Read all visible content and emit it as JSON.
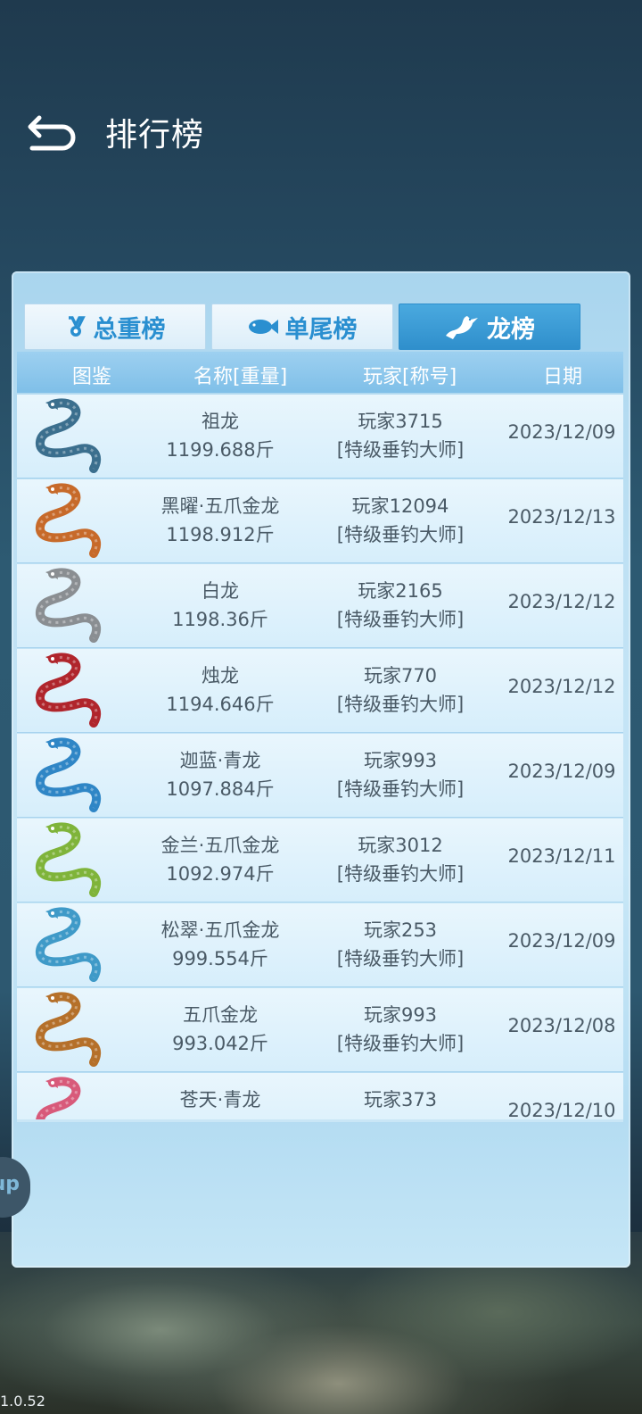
{
  "header": {
    "title": "排行榜"
  },
  "tabs": [
    {
      "label": "总重榜",
      "icon": "trophy-icon"
    },
    {
      "label": "单尾榜",
      "icon": "fish-icon"
    },
    {
      "label": "龙榜",
      "icon": "dragon-icon",
      "active": true
    }
  ],
  "columns": {
    "image": "图鉴",
    "name": "名称[重量]",
    "player": "玩家[称号]",
    "date": "日期"
  },
  "rows": [
    {
      "name": "祖龙",
      "weight": "1199.688斤",
      "player": "玩家3715",
      "title": "[特级垂钓大师]",
      "date": "2023/12/09",
      "dragon_color": "#3b6f8e"
    },
    {
      "name": "黑曜·五爪金龙",
      "weight": "1198.912斤",
      "player": "玩家12094",
      "title": "[特级垂钓大师]",
      "date": "2023/12/13",
      "dragon_color": "#c76a2a"
    },
    {
      "name": "白龙",
      "weight": "1198.36斤",
      "player": "玩家2165",
      "title": "[特级垂钓大师]",
      "date": "2023/12/12",
      "dragon_color": "#8a8e92"
    },
    {
      "name": "烛龙",
      "weight": "1194.646斤",
      "player": "玩家770",
      "title": "[特级垂钓大师]",
      "date": "2023/12/12",
      "dragon_color": "#b0252c"
    },
    {
      "name": "迦蓝·青龙",
      "weight": "1097.884斤",
      "player": "玩家993",
      "title": "[特级垂钓大师]",
      "date": "2023/12/09",
      "dragon_color": "#2f86c6"
    },
    {
      "name": "金兰·五爪金龙",
      "weight": "1092.974斤",
      "player": "玩家3012",
      "title": "[特级垂钓大师]",
      "date": "2023/12/11",
      "dragon_color": "#7fb43a"
    },
    {
      "name": "松翠·五爪金龙",
      "weight": "999.554斤",
      "player": "玩家253",
      "title": "[特级垂钓大师]",
      "date": "2023/12/09",
      "dragon_color": "#3f9ac8"
    },
    {
      "name": "五爪金龙",
      "weight": "993.042斤",
      "player": "玩家993",
      "title": "[特级垂钓大师]",
      "date": "2023/12/08",
      "dragon_color": "#b5702a"
    },
    {
      "name": "苍天·青龙",
      "weight": "",
      "player": "玩家373",
      "title": "",
      "date": "2023/12/10",
      "dragon_color": "#d85a7a"
    }
  ],
  "side_button": {
    "label": "up"
  },
  "version": "1.0.52"
}
